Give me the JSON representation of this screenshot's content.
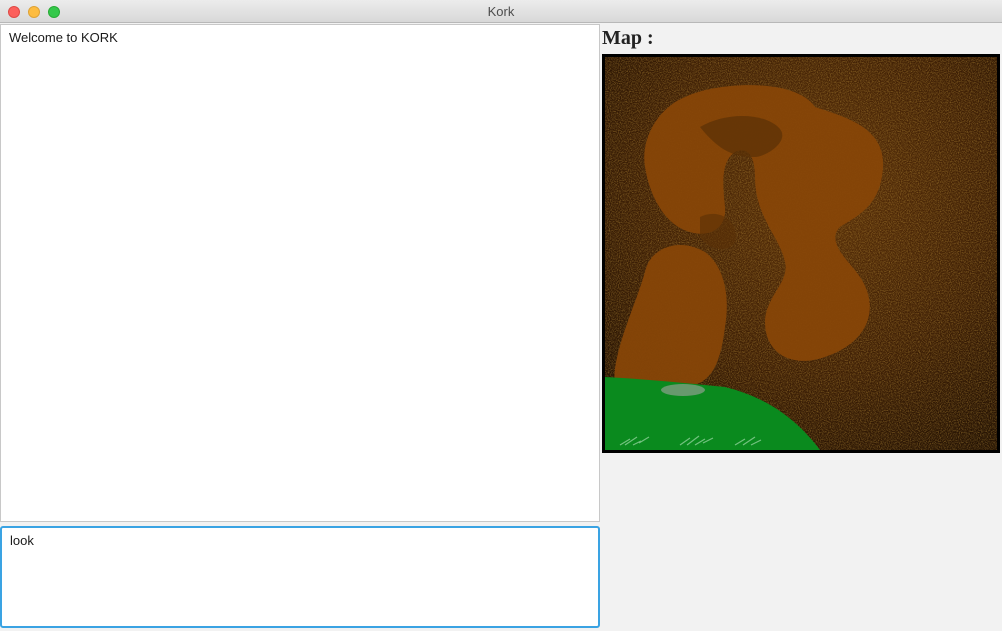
{
  "window": {
    "title": "Kork"
  },
  "output": {
    "text": "Welcome to KORK"
  },
  "command_input": {
    "value": "look"
  },
  "map": {
    "label": "Map :",
    "colors": {
      "ground": "#3c1f05",
      "cave": "#8a4a0a",
      "grass": "#0a8a1e"
    }
  }
}
